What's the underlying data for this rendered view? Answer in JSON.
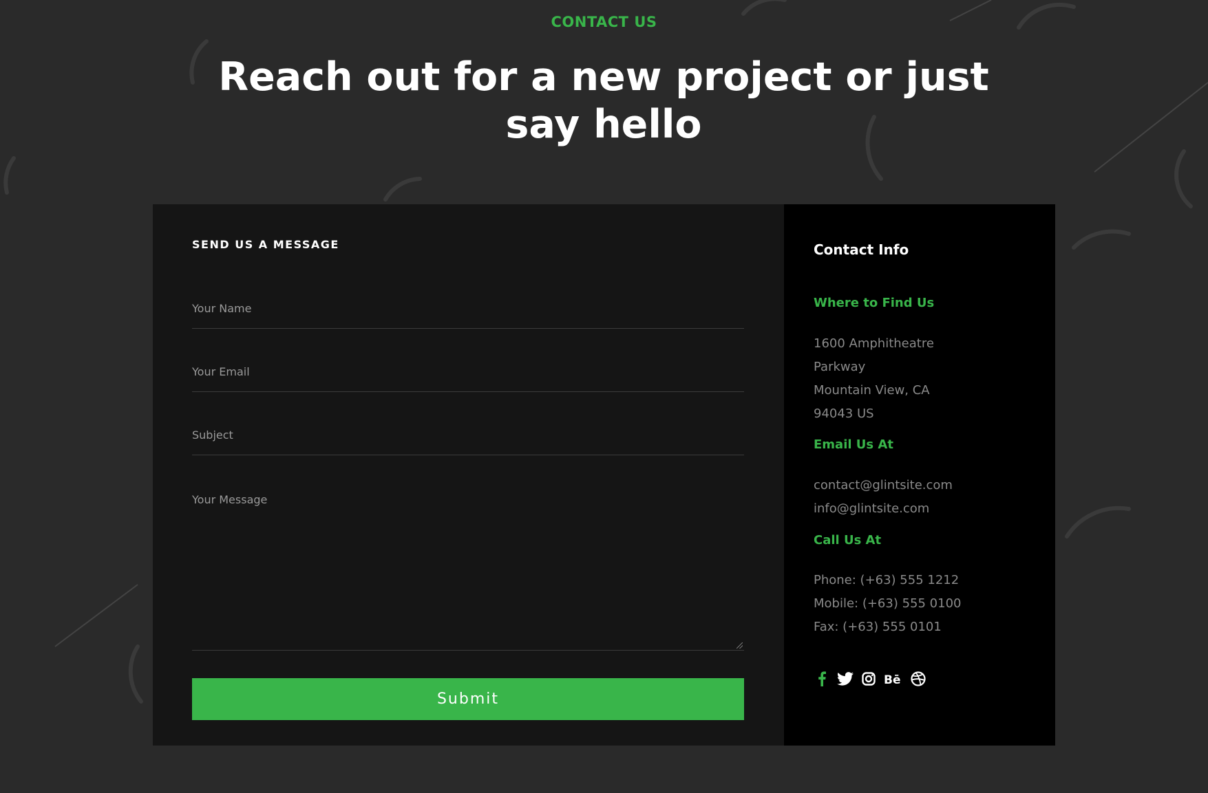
{
  "header": {
    "eyebrow": "CONTACT US",
    "headline": "Reach out for a new project or just say hello"
  },
  "form": {
    "title": "SEND US A MESSAGE",
    "name_placeholder": "Your Name",
    "email_placeholder": "Your Email",
    "subject_placeholder": "Subject",
    "message_placeholder": "Your Message",
    "submit_label": "Submit"
  },
  "info": {
    "title": "Contact Info",
    "location": {
      "heading": "Where to Find Us",
      "lines": [
        "1600 Amphitheatre",
        "Parkway",
        "Mountain View, CA",
        "94043 US"
      ]
    },
    "email": {
      "heading": "Email Us At",
      "lines": [
        "contact@glintsite.com",
        "info@glintsite.com"
      ]
    },
    "phone": {
      "heading": "Call Us At",
      "lines": [
        "Phone: (+63) 555 1212",
        "Mobile: (+63) 555 0100",
        "Fax: (+63) 555 0101"
      ]
    },
    "socials": [
      {
        "icon": "facebook-icon",
        "color": "#39b54a"
      },
      {
        "icon": "twitter-icon",
        "color": "#ffffff"
      },
      {
        "icon": "instagram-icon",
        "color": "#ffffff"
      },
      {
        "icon": "behance-icon",
        "color": "#ffffff"
      },
      {
        "icon": "dribbble-icon",
        "color": "#ffffff"
      }
    ]
  },
  "colors": {
    "accent": "#39b54a",
    "page_bg": "#2a2a2a",
    "form_bg": "#151515",
    "info_bg": "#000000"
  }
}
